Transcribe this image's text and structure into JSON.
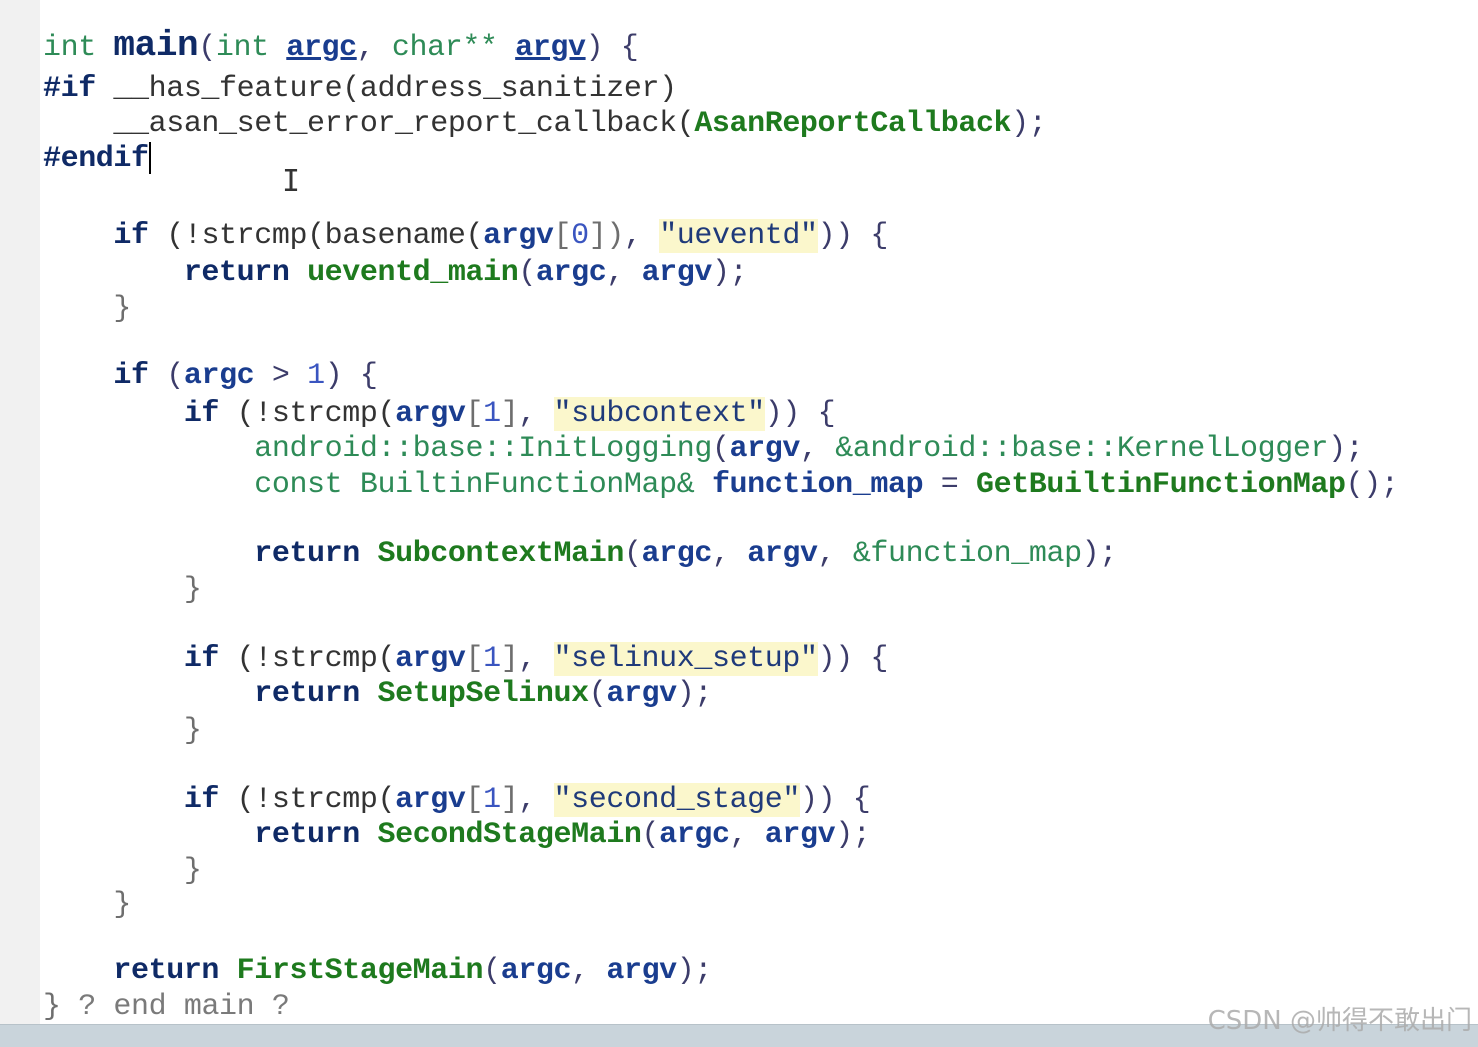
{
  "editor": {
    "lines": [
      [
        {
          "t": "int ",
          "c": "typ"
        },
        {
          "t": "main",
          "c": "fnb"
        },
        {
          "t": "(",
          "c": "pn"
        },
        {
          "t": "int ",
          "c": "typ"
        },
        {
          "t": "argc",
          "c": "par"
        },
        {
          "t": ", ",
          "c": "pn"
        },
        {
          "t": "char** ",
          "c": "typ"
        },
        {
          "t": "argv",
          "c": "par"
        },
        {
          "t": ") {",
          "c": "pn"
        }
      ],
      [
        {
          "t": "#if ",
          "c": "pp"
        },
        {
          "t": "__has_feature(address_sanitizer)",
          "c": "call"
        }
      ],
      [
        {
          "t": "    __asan_set_error_report_callback(",
          "c": "call"
        },
        {
          "t": "AsanReportCallback",
          "c": "fn"
        },
        {
          "t": ");",
          "c": "pn"
        }
      ],
      [
        {
          "t": "#endif",
          "c": "pp"
        }
      ],
      [],
      [
        {
          "t": "    ",
          "c": "pn"
        },
        {
          "t": "if",
          "c": "kw"
        },
        {
          "t": " (!strcmp(basename(",
          "c": "call"
        },
        {
          "t": "argv",
          "c": "var"
        },
        {
          "t": "[",
          "c": "br"
        },
        {
          "t": "0",
          "c": "lit"
        },
        {
          "t": "])",
          "c": "br"
        },
        {
          "t": ", ",
          "c": "pn"
        },
        {
          "t": "\"ueventd\"",
          "c": "str"
        },
        {
          "t": ")) {",
          "c": "pn"
        }
      ],
      [
        {
          "t": "        ",
          "c": "pn"
        },
        {
          "t": "return ",
          "c": "kw"
        },
        {
          "t": "ueventd_main",
          "c": "fn"
        },
        {
          "t": "(",
          "c": "pn"
        },
        {
          "t": "argc",
          "c": "var"
        },
        {
          "t": ", ",
          "c": "pn"
        },
        {
          "t": "argv",
          "c": "var"
        },
        {
          "t": ");",
          "c": "pn"
        }
      ],
      [
        {
          "t": "    }",
          "c": "br"
        }
      ],
      [],
      [
        {
          "t": "    ",
          "c": "pn"
        },
        {
          "t": "if",
          "c": "kw"
        },
        {
          "t": " (",
          "c": "pn"
        },
        {
          "t": "argc",
          "c": "var"
        },
        {
          "t": " > ",
          "c": "pn"
        },
        {
          "t": "1",
          "c": "lit"
        },
        {
          "t": ") {",
          "c": "pn"
        }
      ],
      [
        {
          "t": "        ",
          "c": "pn"
        },
        {
          "t": "if",
          "c": "kw"
        },
        {
          "t": " (!strcmp(",
          "c": "call"
        },
        {
          "t": "argv",
          "c": "var"
        },
        {
          "t": "[",
          "c": "br"
        },
        {
          "t": "1",
          "c": "lit"
        },
        {
          "t": "]",
          "c": "br"
        },
        {
          "t": ", ",
          "c": "pn"
        },
        {
          "t": "\"subcontext\"",
          "c": "str"
        },
        {
          "t": ")) {",
          "c": "pn"
        }
      ],
      [
        {
          "t": "            ",
          "c": "pn"
        },
        {
          "t": "android::base::InitLogging",
          "c": "ns"
        },
        {
          "t": "(",
          "c": "pn"
        },
        {
          "t": "argv",
          "c": "var"
        },
        {
          "t": ", ",
          "c": "pn"
        },
        {
          "t": "&android::base::KernelLogger",
          "c": "ns"
        },
        {
          "t": ");",
          "c": "pn"
        }
      ],
      [
        {
          "t": "            ",
          "c": "pn"
        },
        {
          "t": "const BuiltinFunctionMap& ",
          "c": "typ"
        },
        {
          "t": "function_map",
          "c": "var"
        },
        {
          "t": " = ",
          "c": "pn"
        },
        {
          "t": "GetBuiltinFunctionMap",
          "c": "fn"
        },
        {
          "t": "();",
          "c": "pn"
        }
      ],
      [],
      [
        {
          "t": "            ",
          "c": "pn"
        },
        {
          "t": "return ",
          "c": "kw"
        },
        {
          "t": "SubcontextMain",
          "c": "fn"
        },
        {
          "t": "(",
          "c": "pn"
        },
        {
          "t": "argc",
          "c": "var"
        },
        {
          "t": ", ",
          "c": "pn"
        },
        {
          "t": "argv",
          "c": "var"
        },
        {
          "t": ", ",
          "c": "pn"
        },
        {
          "t": "&function_map",
          "c": "ns"
        },
        {
          "t": ");",
          "c": "pn"
        }
      ],
      [
        {
          "t": "        }",
          "c": "br"
        }
      ],
      [],
      [
        {
          "t": "        ",
          "c": "pn"
        },
        {
          "t": "if",
          "c": "kw"
        },
        {
          "t": " (!strcmp(",
          "c": "call"
        },
        {
          "t": "argv",
          "c": "var"
        },
        {
          "t": "[",
          "c": "br"
        },
        {
          "t": "1",
          "c": "lit"
        },
        {
          "t": "]",
          "c": "br"
        },
        {
          "t": ", ",
          "c": "pn"
        },
        {
          "t": "\"selinux_setup\"",
          "c": "str"
        },
        {
          "t": ")) {",
          "c": "pn"
        }
      ],
      [
        {
          "t": "            ",
          "c": "pn"
        },
        {
          "t": "return ",
          "c": "kw"
        },
        {
          "t": "SetupSelinux",
          "c": "fn"
        },
        {
          "t": "(",
          "c": "pn"
        },
        {
          "t": "argv",
          "c": "var"
        },
        {
          "t": ");",
          "c": "pn"
        }
      ],
      [
        {
          "t": "        }",
          "c": "br"
        }
      ],
      [],
      [
        {
          "t": "        ",
          "c": "pn"
        },
        {
          "t": "if",
          "c": "kw"
        },
        {
          "t": " (!strcmp(",
          "c": "call"
        },
        {
          "t": "argv",
          "c": "var"
        },
        {
          "t": "[",
          "c": "br"
        },
        {
          "t": "1",
          "c": "lit"
        },
        {
          "t": "]",
          "c": "br"
        },
        {
          "t": ", ",
          "c": "pn"
        },
        {
          "t": "\"second_stage\"",
          "c": "str"
        },
        {
          "t": ")) {",
          "c": "pn"
        }
      ],
      [
        {
          "t": "            ",
          "c": "pn"
        },
        {
          "t": "return ",
          "c": "kw"
        },
        {
          "t": "SecondStageMain",
          "c": "fn"
        },
        {
          "t": "(",
          "c": "pn"
        },
        {
          "t": "argc",
          "c": "var"
        },
        {
          "t": ", ",
          "c": "pn"
        },
        {
          "t": "argv",
          "c": "var"
        },
        {
          "t": ");",
          "c": "pn"
        }
      ],
      [
        {
          "t": "        }",
          "c": "br"
        }
      ],
      [
        {
          "t": "    }",
          "c": "br"
        }
      ],
      [],
      [
        {
          "t": "    ",
          "c": "pn"
        },
        {
          "t": "return ",
          "c": "kw"
        },
        {
          "t": "FirstStageMain",
          "c": "fn"
        },
        {
          "t": "(",
          "c": "pn"
        },
        {
          "t": "argc",
          "c": "var"
        },
        {
          "t": ", ",
          "c": "pn"
        },
        {
          "t": "argv",
          "c": "var"
        },
        {
          "t": ");",
          "c": "pn"
        }
      ],
      [
        {
          "t": "} ",
          "c": "br"
        },
        {
          "t": "? end main ?",
          "c": "cmt"
        }
      ]
    ],
    "caret_line": 3
  },
  "watermark": "CSDN @帅得不敢出门"
}
